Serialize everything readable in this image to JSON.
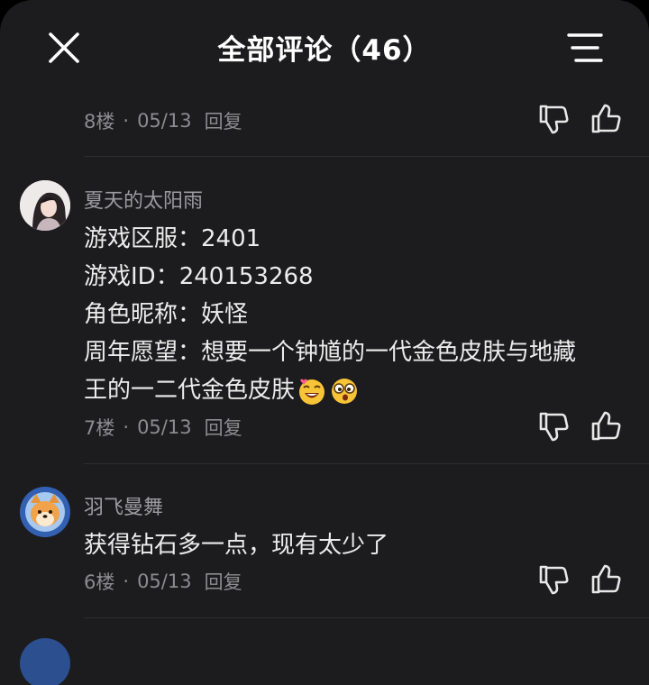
{
  "header": {
    "title": "全部评论（46）",
    "close_icon": "close-icon",
    "menu_icon": "menu-lines-icon"
  },
  "colors": {
    "background": "#1c1c1e",
    "text_primary": "#ececec",
    "text_secondary": "#9b9ba0",
    "divider": "#2e2e31"
  },
  "comments": [
    {
      "floor": "8楼",
      "date": "05/13",
      "reply": "回复"
    },
    {
      "username": "夏天的太阳雨",
      "lines": [
        "游戏区服：2401",
        "游戏ID：240153268",
        "角色昵称：妖怪",
        "周年愿望：想要一个钟馗的一代金色皮肤与地藏",
        "王的一二代金色皮肤"
      ],
      "emojis": [
        "grinning-face-with-heart-emoji",
        "peeking-surprised-face-emoji"
      ],
      "floor": "7楼",
      "date": "05/13",
      "reply": "回复"
    },
    {
      "username": "羽飞曼舞",
      "lines": [
        "获得钻石多一点，现有太少了"
      ],
      "floor": "6楼",
      "date": "05/13",
      "reply": "回复"
    }
  ],
  "meta_separator": "·"
}
